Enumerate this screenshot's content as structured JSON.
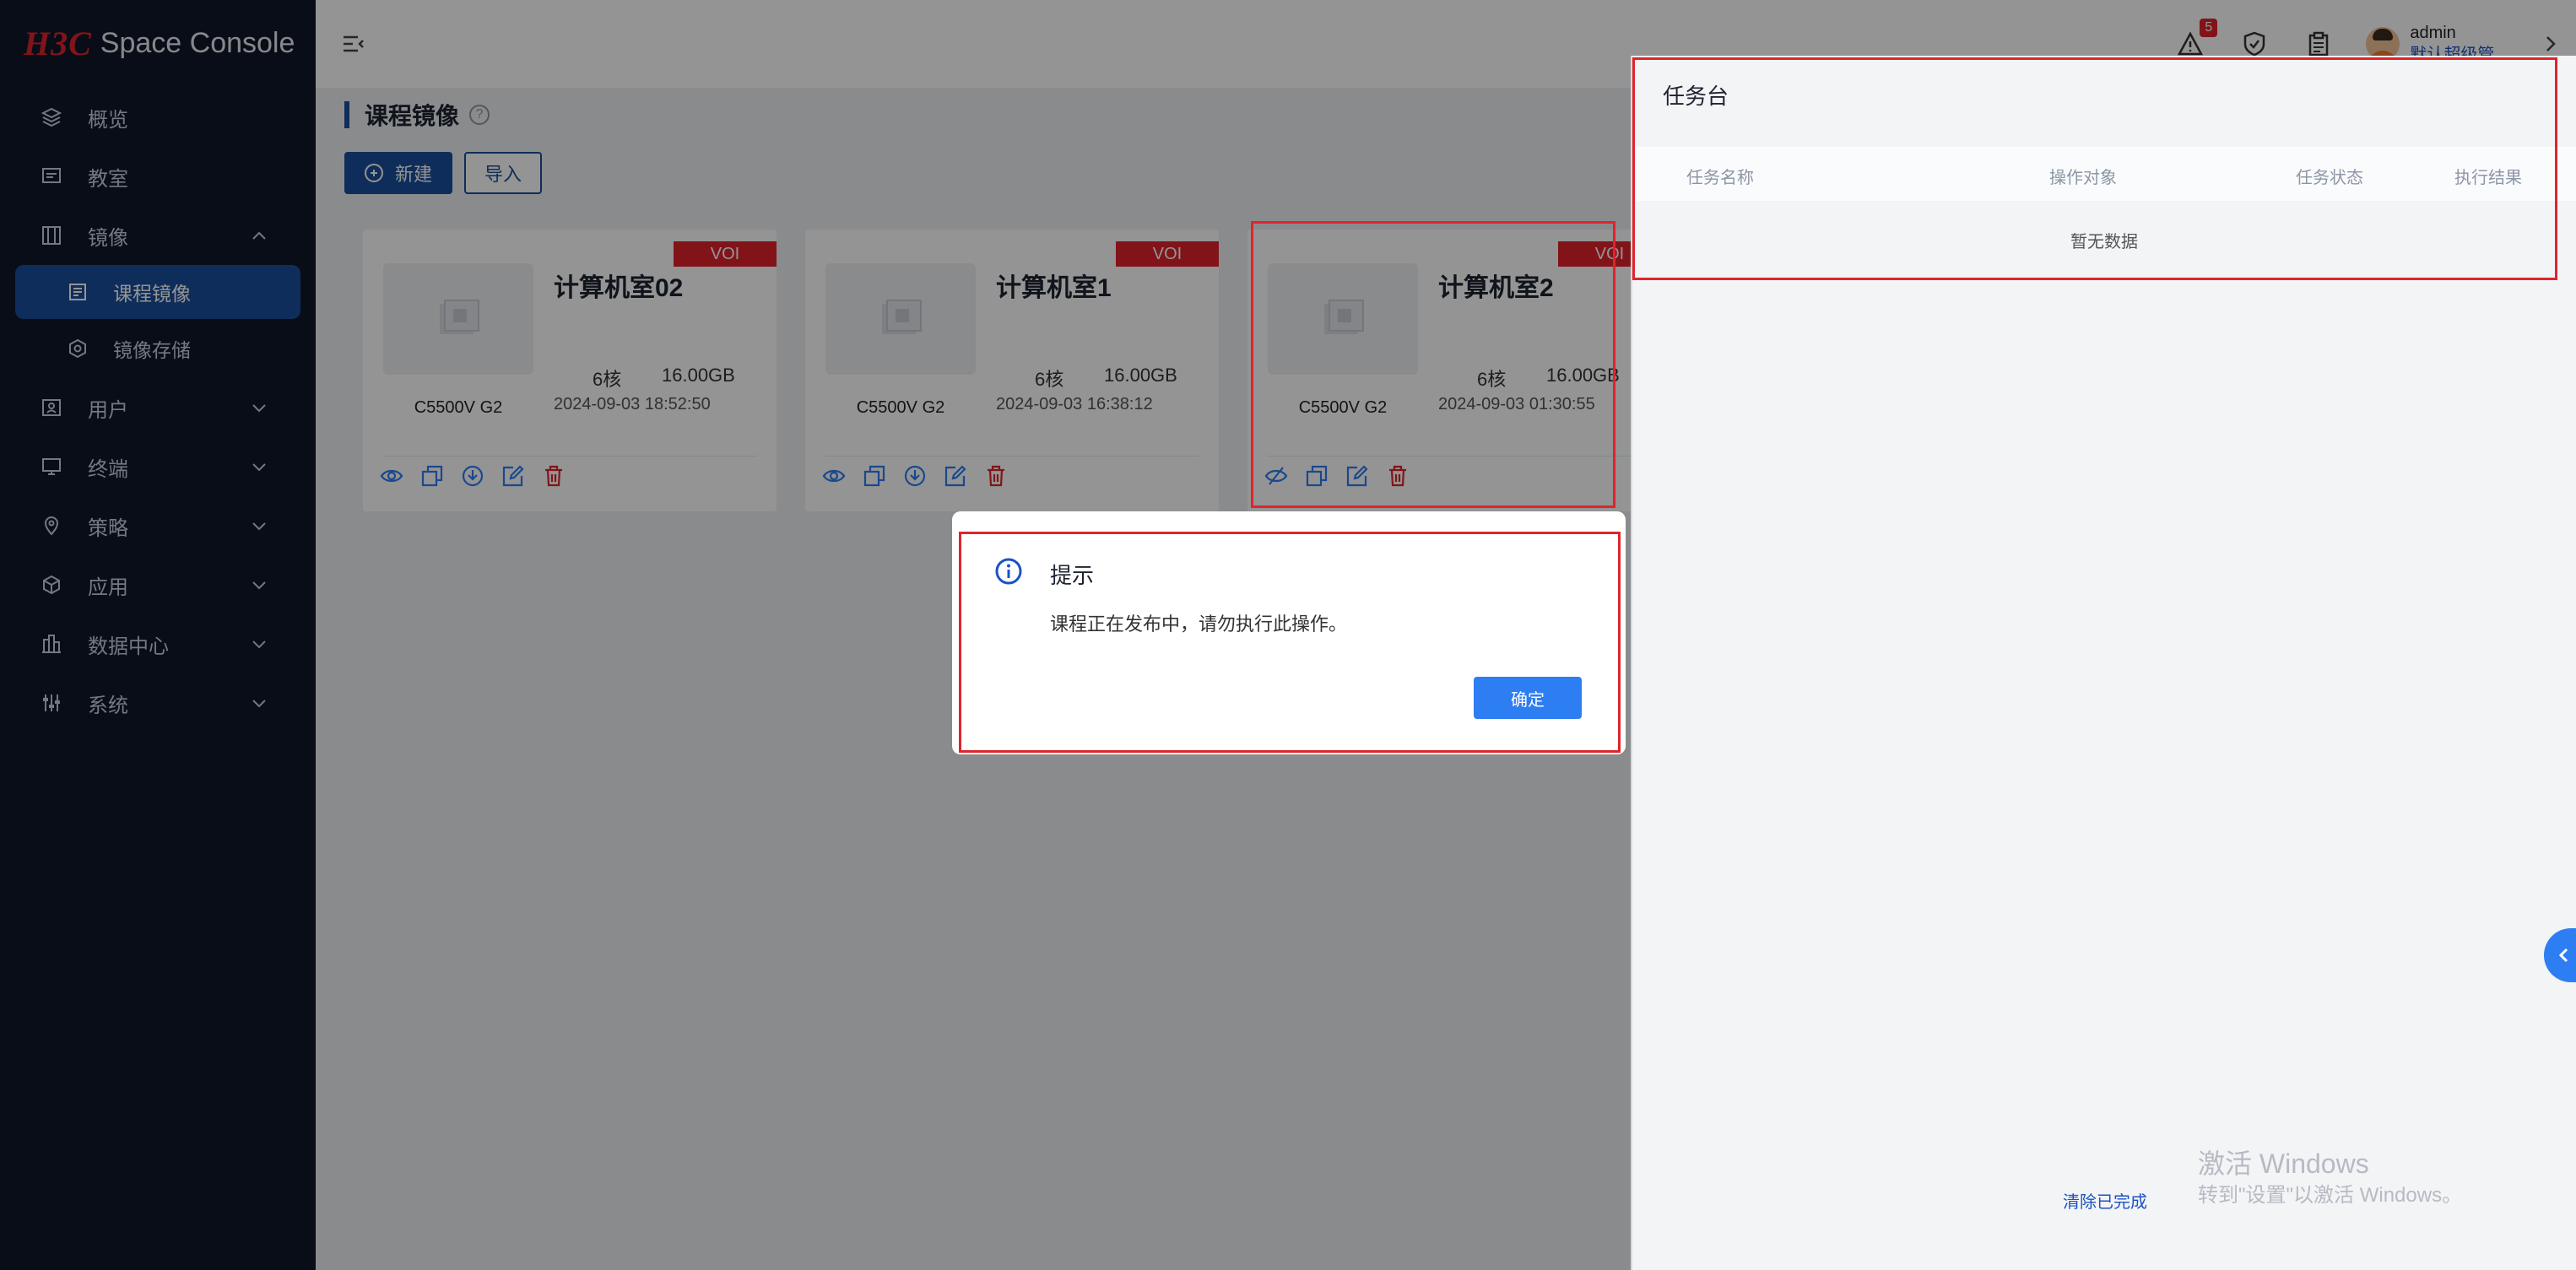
{
  "brand": {
    "logo": "H3C",
    "product": "Space Console"
  },
  "sidebar": {
    "items": [
      {
        "label": "概览"
      },
      {
        "label": "教室"
      },
      {
        "label": "镜像"
      },
      {
        "label": "课程镜像"
      },
      {
        "label": "镜像存储"
      },
      {
        "label": "用户"
      },
      {
        "label": "终端"
      },
      {
        "label": "策略"
      },
      {
        "label": "应用"
      },
      {
        "label": "数据中心"
      },
      {
        "label": "系统"
      }
    ]
  },
  "header": {
    "alarm_count": "5",
    "user": {
      "name": "admin",
      "role": "默认超级管..."
    }
  },
  "page": {
    "title": "课程镜像",
    "help": "?",
    "new_label": "新建",
    "import_label": "导入"
  },
  "cards": [
    {
      "name": "计算机室02",
      "tag": "VOI",
      "cores": "6核",
      "memory": "16.00GB",
      "model": "C5500V G2",
      "time": "2024-09-03 18:52:50"
    },
    {
      "name": "计算机室1",
      "tag": "VOI",
      "cores": "6核",
      "memory": "16.00GB",
      "model": "C5500V G2",
      "time": "2024-09-03 16:38:12"
    },
    {
      "name": "计算机室2",
      "tag": "VOI",
      "cores": "6核",
      "memory": "16.00GB",
      "model": "C5500V G2",
      "time": "2024-09-03 01:30:55"
    }
  ],
  "task_panel": {
    "title": "任务台",
    "columns": [
      "任务名称",
      "操作对象",
      "任务状态",
      "执行结果"
    ],
    "empty": "暂无数据",
    "clear_label": "清除已完成"
  },
  "watermark": {
    "line1": "激活 Windows",
    "line2": "转到\"设置\"以激活 Windows。"
  },
  "dialog": {
    "title": "提示",
    "message": "课程正在发布中，请勿执行此操作。",
    "ok_label": "确定"
  },
  "colors": {
    "sidebar": "#0e1729",
    "primary": "#1b4f9c",
    "accent": "#2d7df3",
    "tag": "#e0242c"
  }
}
